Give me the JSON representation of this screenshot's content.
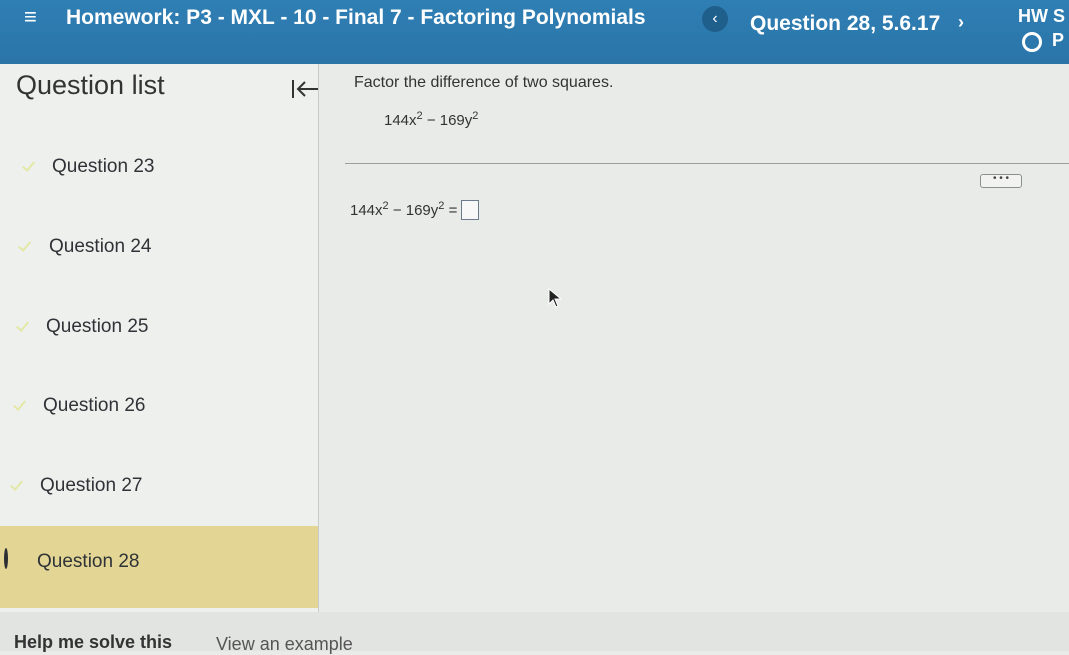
{
  "header": {
    "menu_icon": "hamburger-icon",
    "homework_title": "Homework: P3 - MXL - 10 - Final 7 - Factoring Polynomials",
    "prev_icon": "chevron-left-icon",
    "question_title": "Question 28, 5.6.17",
    "next_icon": "chevron-right-icon",
    "hw_score_label": "HW S",
    "points_label": "P"
  },
  "sidebar": {
    "title": "Question list",
    "collapse_icon": "collapse-left-icon",
    "items": [
      {
        "label": "Question 23",
        "status": "complete"
      },
      {
        "label": "Question 24",
        "status": "complete"
      },
      {
        "label": "Question 25",
        "status": "complete"
      },
      {
        "label": "Question 26",
        "status": "complete"
      },
      {
        "label": "Question 27",
        "status": "complete"
      },
      {
        "label": "Question 28",
        "status": "current"
      }
    ]
  },
  "main": {
    "prompt": "Factor the difference of two squares.",
    "expression": {
      "a": "144x",
      "exp1": "2",
      "minus": " − 169y",
      "exp2": "2"
    },
    "answer": {
      "lhs_a": "144x",
      "exp1": "2",
      "lhs_b": " − 169y",
      "exp2": "2",
      "equals": " ="
    },
    "more_button": "• • •"
  },
  "footer": {
    "help_label": "Help me solve this",
    "example_label": "View an example"
  },
  "colors": {
    "header_bg": "#2f7fb4",
    "active_item_bg": "#e3d594",
    "check_mark": "#2b2f33"
  }
}
